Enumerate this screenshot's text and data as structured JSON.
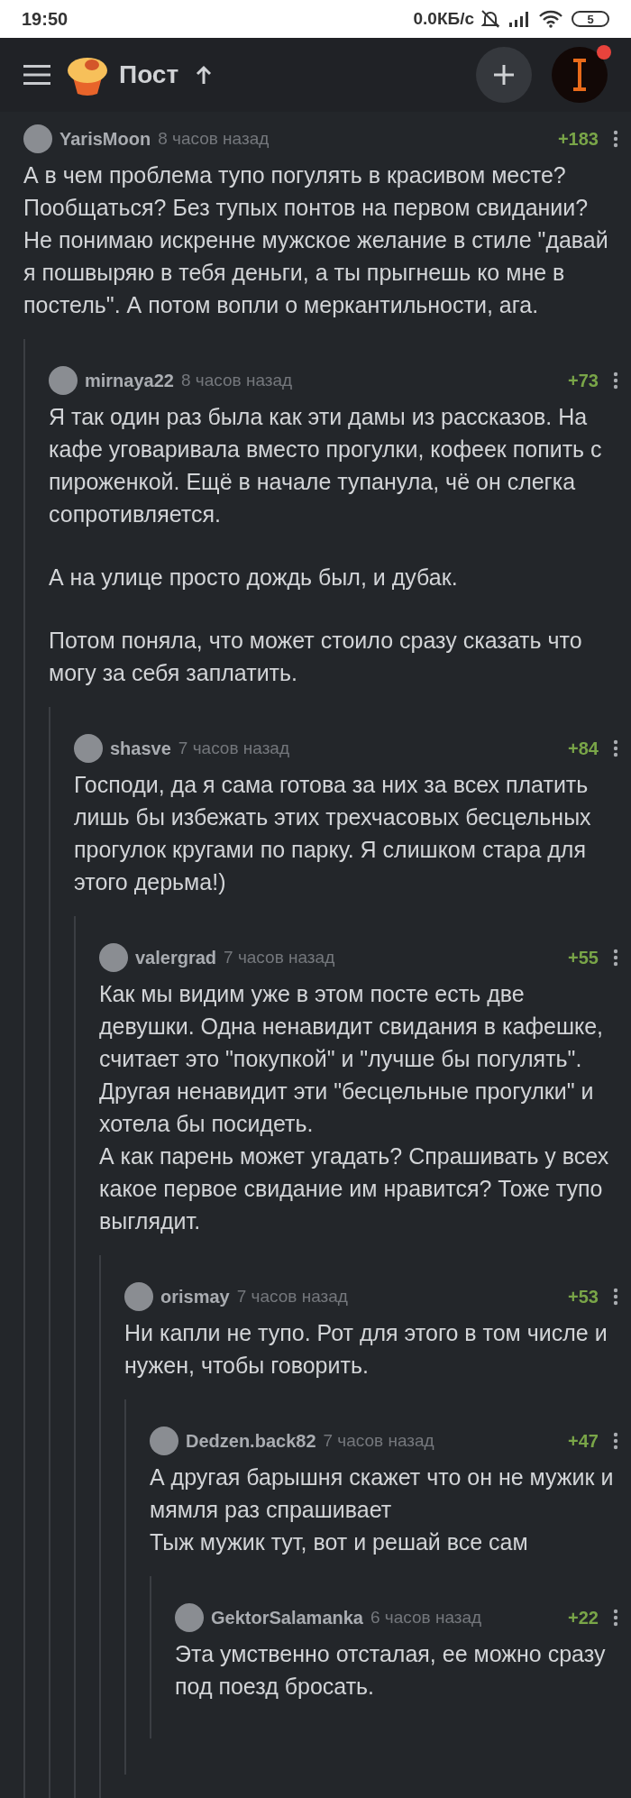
{
  "status_bar": {
    "time": "19:50",
    "network_speed": "0.0КБ/с",
    "battery": "5"
  },
  "header": {
    "title": "Пост",
    "notification_dot": true
  },
  "comments": [
    {
      "author": "YarisMoon",
      "time": "8 часов назад",
      "score": "+183",
      "body": [
        "А в чем проблема тупо погулять в красивом месте? Пообщаться? Без тупых понтов на первом свидании? Не понимаю искренне мужское желание в стиле \"давай я пошвыряю в тебя деньги, а ты прыгнешь ко мне в постель\". А потом вопли о меркантильности, ага."
      ],
      "children": [
        {
          "author": "mirnaya22",
          "time": "8 часов назад",
          "score": "+73",
          "body": [
            "Я так один раз была как эти дамы из рассказов. На кафе уговаривала вместо прогулки, кофеек попить с пироженкой. Ещё в начале тупанула, чё он слегка сопротивляется.",
            "А на улице просто дождь был, и дубак.",
            "Потом поняла, что может стоило сразу сказать что могу за себя заплатить."
          ],
          "children": [
            {
              "author": "shasve",
              "time": "7 часов назад",
              "score": "+84",
              "body": [
                "Господи,  да я сама готова за них за всех платить лишь бы избежать этих трехчасовых бесцельных прогулок кругами по парку. Я слишком стара для этого дерьма!)"
              ],
              "children": [
                {
                  "author": "valergrad",
                  "time": "7 часов назад",
                  "score": "+55",
                  "body": [
                    "Как мы видим уже в этом посте есть две девушки.  Одна ненавидит свидания в кафешке, считает это \"покупкой\" и \"лучше бы погулять\".\nДругая ненавидит эти \"бесцельные прогулки\" и хотела бы посидеть.\nА как парень может угадать? Спрашивать у всех какое первое свидание им нравится? Тоже тупо выглядит."
                  ],
                  "children": [
                    {
                      "author": "orismay",
                      "time": "7 часов назад",
                      "score": "+53",
                      "body": [
                        "Ни капли не тупо. Рот для этого в том числе и нужен, чтобы говорить."
                      ],
                      "children": [
                        {
                          "author": "Dedzen.back82",
                          "time": "7 часов назад",
                          "score": "+47",
                          "body": [
                            "А другая барышня скажет что он не мужик и мямля раз спрашивает\nТыж мужик тут, вот и решай все сам"
                          ],
                          "children": [
                            {
                              "author": "GektorSalamanka",
                              "time": "6 часов назад",
                              "score": "+22",
                              "body": [
                                "Эта умственно отсталая, ее можно сразу под поезд бросать."
                              ]
                            }
                          ]
                        }
                      ]
                    }
                  ]
                }
              ]
            }
          ]
        }
      ]
    }
  ]
}
